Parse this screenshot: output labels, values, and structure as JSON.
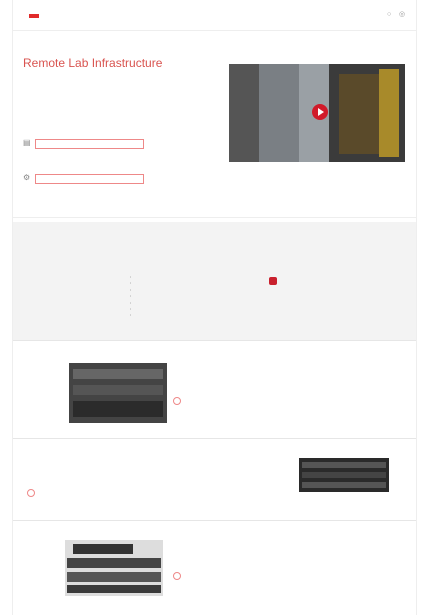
{
  "header": {
    "logo_text": "",
    "nav": [
      "",
      "",
      ""
    ],
    "signin_label": "",
    "search_icon": "search-icon",
    "globe_icon": "globe-icon"
  },
  "breadcrumb": "",
  "hero": {
    "title": "Remote Lab Infrastructure",
    "description": "",
    "video_play_icon": "play-icon"
  },
  "leads": [
    {
      "label": "",
      "field_text": "",
      "icon": "document-icon"
    },
    {
      "label": "",
      "field_text": "",
      "icon": "gear-icon"
    }
  ],
  "tabs": [
    "",
    "",
    "",
    "",
    "",
    "",
    "",
    "",
    "",
    "",
    "",
    "",
    "",
    "",
    ""
  ],
  "band": {
    "title": "",
    "subtitle": "",
    "items": [
      "",
      "",
      "",
      "",
      "",
      "",
      ""
    ],
    "cta_label": ""
  },
  "products": [
    {
      "title": "",
      "description": "",
      "link_label": ""
    },
    {
      "title": "",
      "description": "",
      "link_label": ""
    },
    {
      "title": "",
      "description": "",
      "link_label": ""
    }
  ],
  "colors": {
    "accent": "#d9534f",
    "play": "#d11a2a"
  }
}
